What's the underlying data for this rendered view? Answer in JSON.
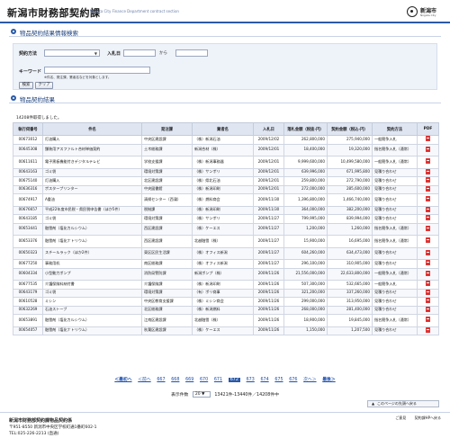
{
  "header": {
    "title": "新潟市財務部契約課",
    "subtitle": "Niigata City Finance Department contract section",
    "logo_text": "新潟市",
    "logo_sub": "Niigata City"
  },
  "search": {
    "section_title": "物品契約結果情報検索",
    "method_label": "契約方法",
    "date_label": "入札日",
    "date_sep": "から",
    "keyword_label": "キーワード",
    "note": "※件名、発注課、業者名などを対象とします。",
    "search_button": "検索",
    "clear_button": "クリア"
  },
  "results": {
    "section_title": "物品契約結果",
    "count_text": "14208件取得しました。",
    "headers": [
      "執行伺番号",
      "件名",
      "発注課",
      "業者名",
      "入札日",
      "落札金額（税抜-円）",
      "契約金額（税込-円）",
      "契約方法",
      "PDF"
    ],
    "rows": [
      [
        "00673012",
        "灯油購入",
        "中央区建設課",
        "（株）新潟石油",
        "2009/12/02",
        "262,800,000",
        "275,940,000",
        "一般競争入札",
        ""
      ],
      [
        "00645308",
        "舗装用アスファルト合材単価契約",
        "土木総務課",
        "新潟合材（株）",
        "2009/12/01",
        "18,400,000",
        "19,320,000",
        "指名競争入札（通常）",
        ""
      ],
      [
        "00611611",
        "電子黒板機能付きデジタルテレビ",
        "学校支援課",
        "（株）新潟事務器",
        "2009/12/01",
        "9,999,600,000",
        "10,499,580,000",
        "一般競争入札（通常）",
        ""
      ],
      [
        "00643163",
        "ゴミ袋",
        "環境対策課",
        "（株）サンポリ",
        "2009/12/01",
        "639,996,000",
        "671,995,800",
        "見積り合わせ",
        ""
      ],
      [
        "00675140",
        "灯油購入",
        "北区建設課",
        "（株）県北石油",
        "2009/12/01",
        "259,800,000",
        "272,790,000",
        "見積り合わせ",
        ""
      ],
      [
        "00636316",
        "ポスタープリンター",
        "中央図書館",
        "（株）新潟印刷",
        "2009/12/01",
        "272,000,000",
        "285,600,000",
        "見積り合わせ",
        ""
      ],
      [
        "00674917",
        "A重油",
        "清掃センター（西蒲）",
        "（株）燃料商会",
        "2009/11/30",
        "1,396,800,000",
        "1,466,740,000",
        "見積り合わせ",
        ""
      ],
      [
        "00676657",
        "平成22年度市民税・県民税申告書（ほか5件）",
        "税制課",
        "（株）新潟印刷",
        "2009/11/30",
        "364,000,000",
        "382,200,000",
        "見積り合わせ",
        ""
      ],
      [
        "00643185",
        "ゴミ袋",
        "環境対策課",
        "（株）サンポリ",
        "2009/11/27",
        "799,995,000",
        "839,994,000",
        "見積り合わせ",
        ""
      ],
      [
        "00653441",
        "融雪剤（塩化カルシウム）",
        "西区建設課",
        "（株）ケーエス",
        "2009/11/27",
        "1,200,000",
        "1,260,000",
        "指名競争入札（通常）",
        ""
      ],
      [
        "00653376",
        "融雪剤（塩化ナトリウム）",
        "西区建設課",
        "北越融雪（株）",
        "2009/11/27",
        "15,900,000",
        "16,695,000",
        "指名競争入札（通常）",
        ""
      ],
      [
        "00650323",
        "スチールラック（ほか2件）",
        "東区区民生活課",
        "（株）オフィス新潟",
        "2009/11/27",
        "604,260,000",
        "634,473,000",
        "見積り合わせ",
        ""
      ],
      [
        "00677250",
        "事務用机",
        "南区総務課",
        "（株）オフィス新潟",
        "2009/11/27",
        "296,100,000",
        "310,905,000",
        "見積り合わせ",
        ""
      ],
      [
        "00604334",
        "小型動力ポンプ",
        "消防局警防課",
        "新潟ポンプ（株）",
        "2009/11/26",
        "21,556,000,000",
        "22,633,800,000",
        "一般競争入札（通常）",
        ""
      ],
      [
        "00677535",
        "介護保険料納付書",
        "介護保険課",
        "（株）新潟印刷",
        "2009/11/26",
        "507,300,000",
        "532,665,000",
        "一般競争入札",
        ""
      ],
      [
        "00643179",
        "ゴミ袋",
        "環境対策課",
        "（有）ポリ商事",
        "2009/11/26",
        "321,200,000",
        "337,260,000",
        "見積り合わせ",
        ""
      ],
      [
        "00610528",
        "ミシン",
        "中央区教育支援課",
        "（株）ミシン商会",
        "2009/11/26",
        "299,000,000",
        "313,950,000",
        "見積り合わせ",
        ""
      ],
      [
        "00632269",
        "石油ストーブ",
        "北区総務課",
        "（株）新潟燃料",
        "2009/11/26",
        "268,000,000",
        "281,400,000",
        "見積り合わせ",
        ""
      ],
      [
        "00653891",
        "融雪剤（塩化カルシウム）",
        "江南区建設課",
        "北越融雪（株）",
        "2009/11/26",
        "18,900,000",
        "19,845,000",
        "指名競争入札（通常）",
        ""
      ],
      [
        "00654057",
        "融雪剤（塩化ナトリウム）",
        "秋葉区建設課",
        "（株）ケーエス",
        "2009/11/26",
        "1,150,000",
        "1,207,500",
        "見積り合わせ",
        ""
      ]
    ]
  },
  "pager": {
    "first": "＜最初へ",
    "prev": "＜前へ",
    "pages": [
      "667",
      "668",
      "669",
      "670",
      "671",
      "672",
      "673",
      "674",
      "675",
      "676"
    ],
    "current": "672",
    "next": "次へ＞",
    "last": "最後＞"
  },
  "perpage": {
    "label": "表示件数",
    "value": "20",
    "range_text": "13421件-13440件／14208件中"
  },
  "return_link": "このページの先頭へ戻る",
  "footer": {
    "name": "新潟市財務部契約課物品契約係",
    "address": "〒951-8550 新潟市中央区学校町通1番町602-1",
    "tel": "TEL:025-226-2213 (直通)",
    "links": [
      "ご意見",
      "契約課HPへ戻る"
    ]
  }
}
